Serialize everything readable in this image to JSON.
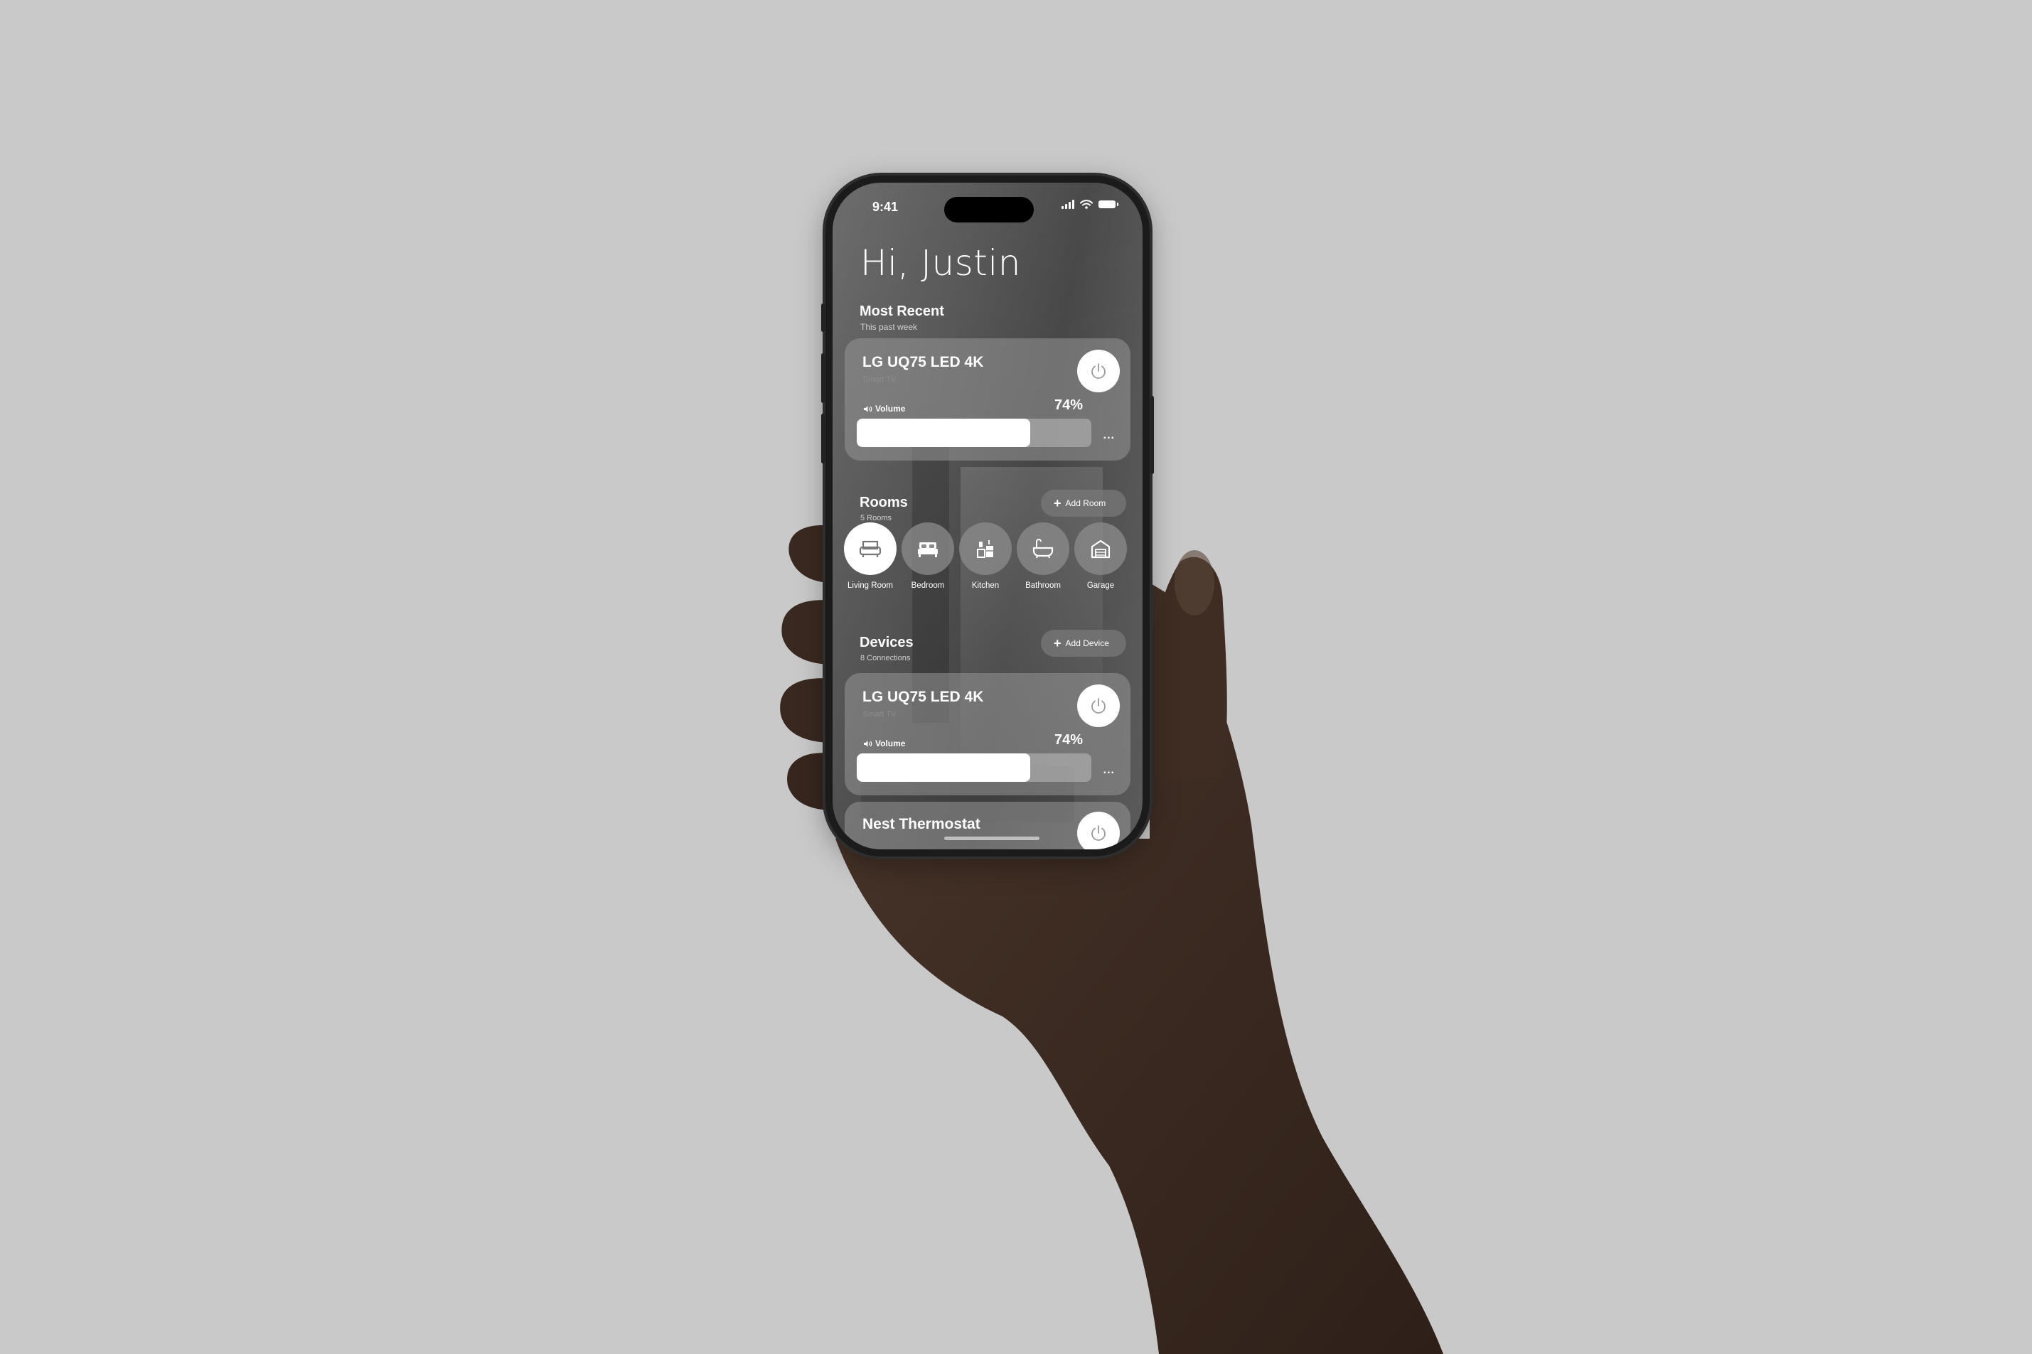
{
  "status_bar": {
    "time": "9:41"
  },
  "greeting": "Hi, Justin",
  "most_recent": {
    "title": "Most Recent",
    "subtitle": "This past week",
    "card": {
      "name": "LG UQ75 LED 4K",
      "type": "Smart TV",
      "control_label": "Volume",
      "value_text": "74%",
      "value": 0.74,
      "more": "..."
    }
  },
  "rooms": {
    "title": "Rooms",
    "subtitle": "5 Rooms",
    "add_label": "Add Room",
    "items": [
      {
        "label": "Living Room",
        "icon": "sofa-icon",
        "active": true
      },
      {
        "label": "Bedroom",
        "icon": "bed-icon",
        "active": false
      },
      {
        "label": "Kitchen",
        "icon": "kitchen-icon",
        "active": false
      },
      {
        "label": "Bathroom",
        "icon": "bathtub-icon",
        "active": false
      },
      {
        "label": "Garage",
        "icon": "garage-icon",
        "active": false
      }
    ]
  },
  "devices": {
    "title": "Devices",
    "subtitle": "8 Connections",
    "add_label": "Add Device",
    "items": [
      {
        "name": "LG UQ75 LED 4K",
        "type": "Smart TV",
        "control_label": "Volume",
        "value_text": "74%",
        "value": 0.74,
        "more": "..."
      },
      {
        "name": "Nest Thermostat"
      }
    ]
  }
}
